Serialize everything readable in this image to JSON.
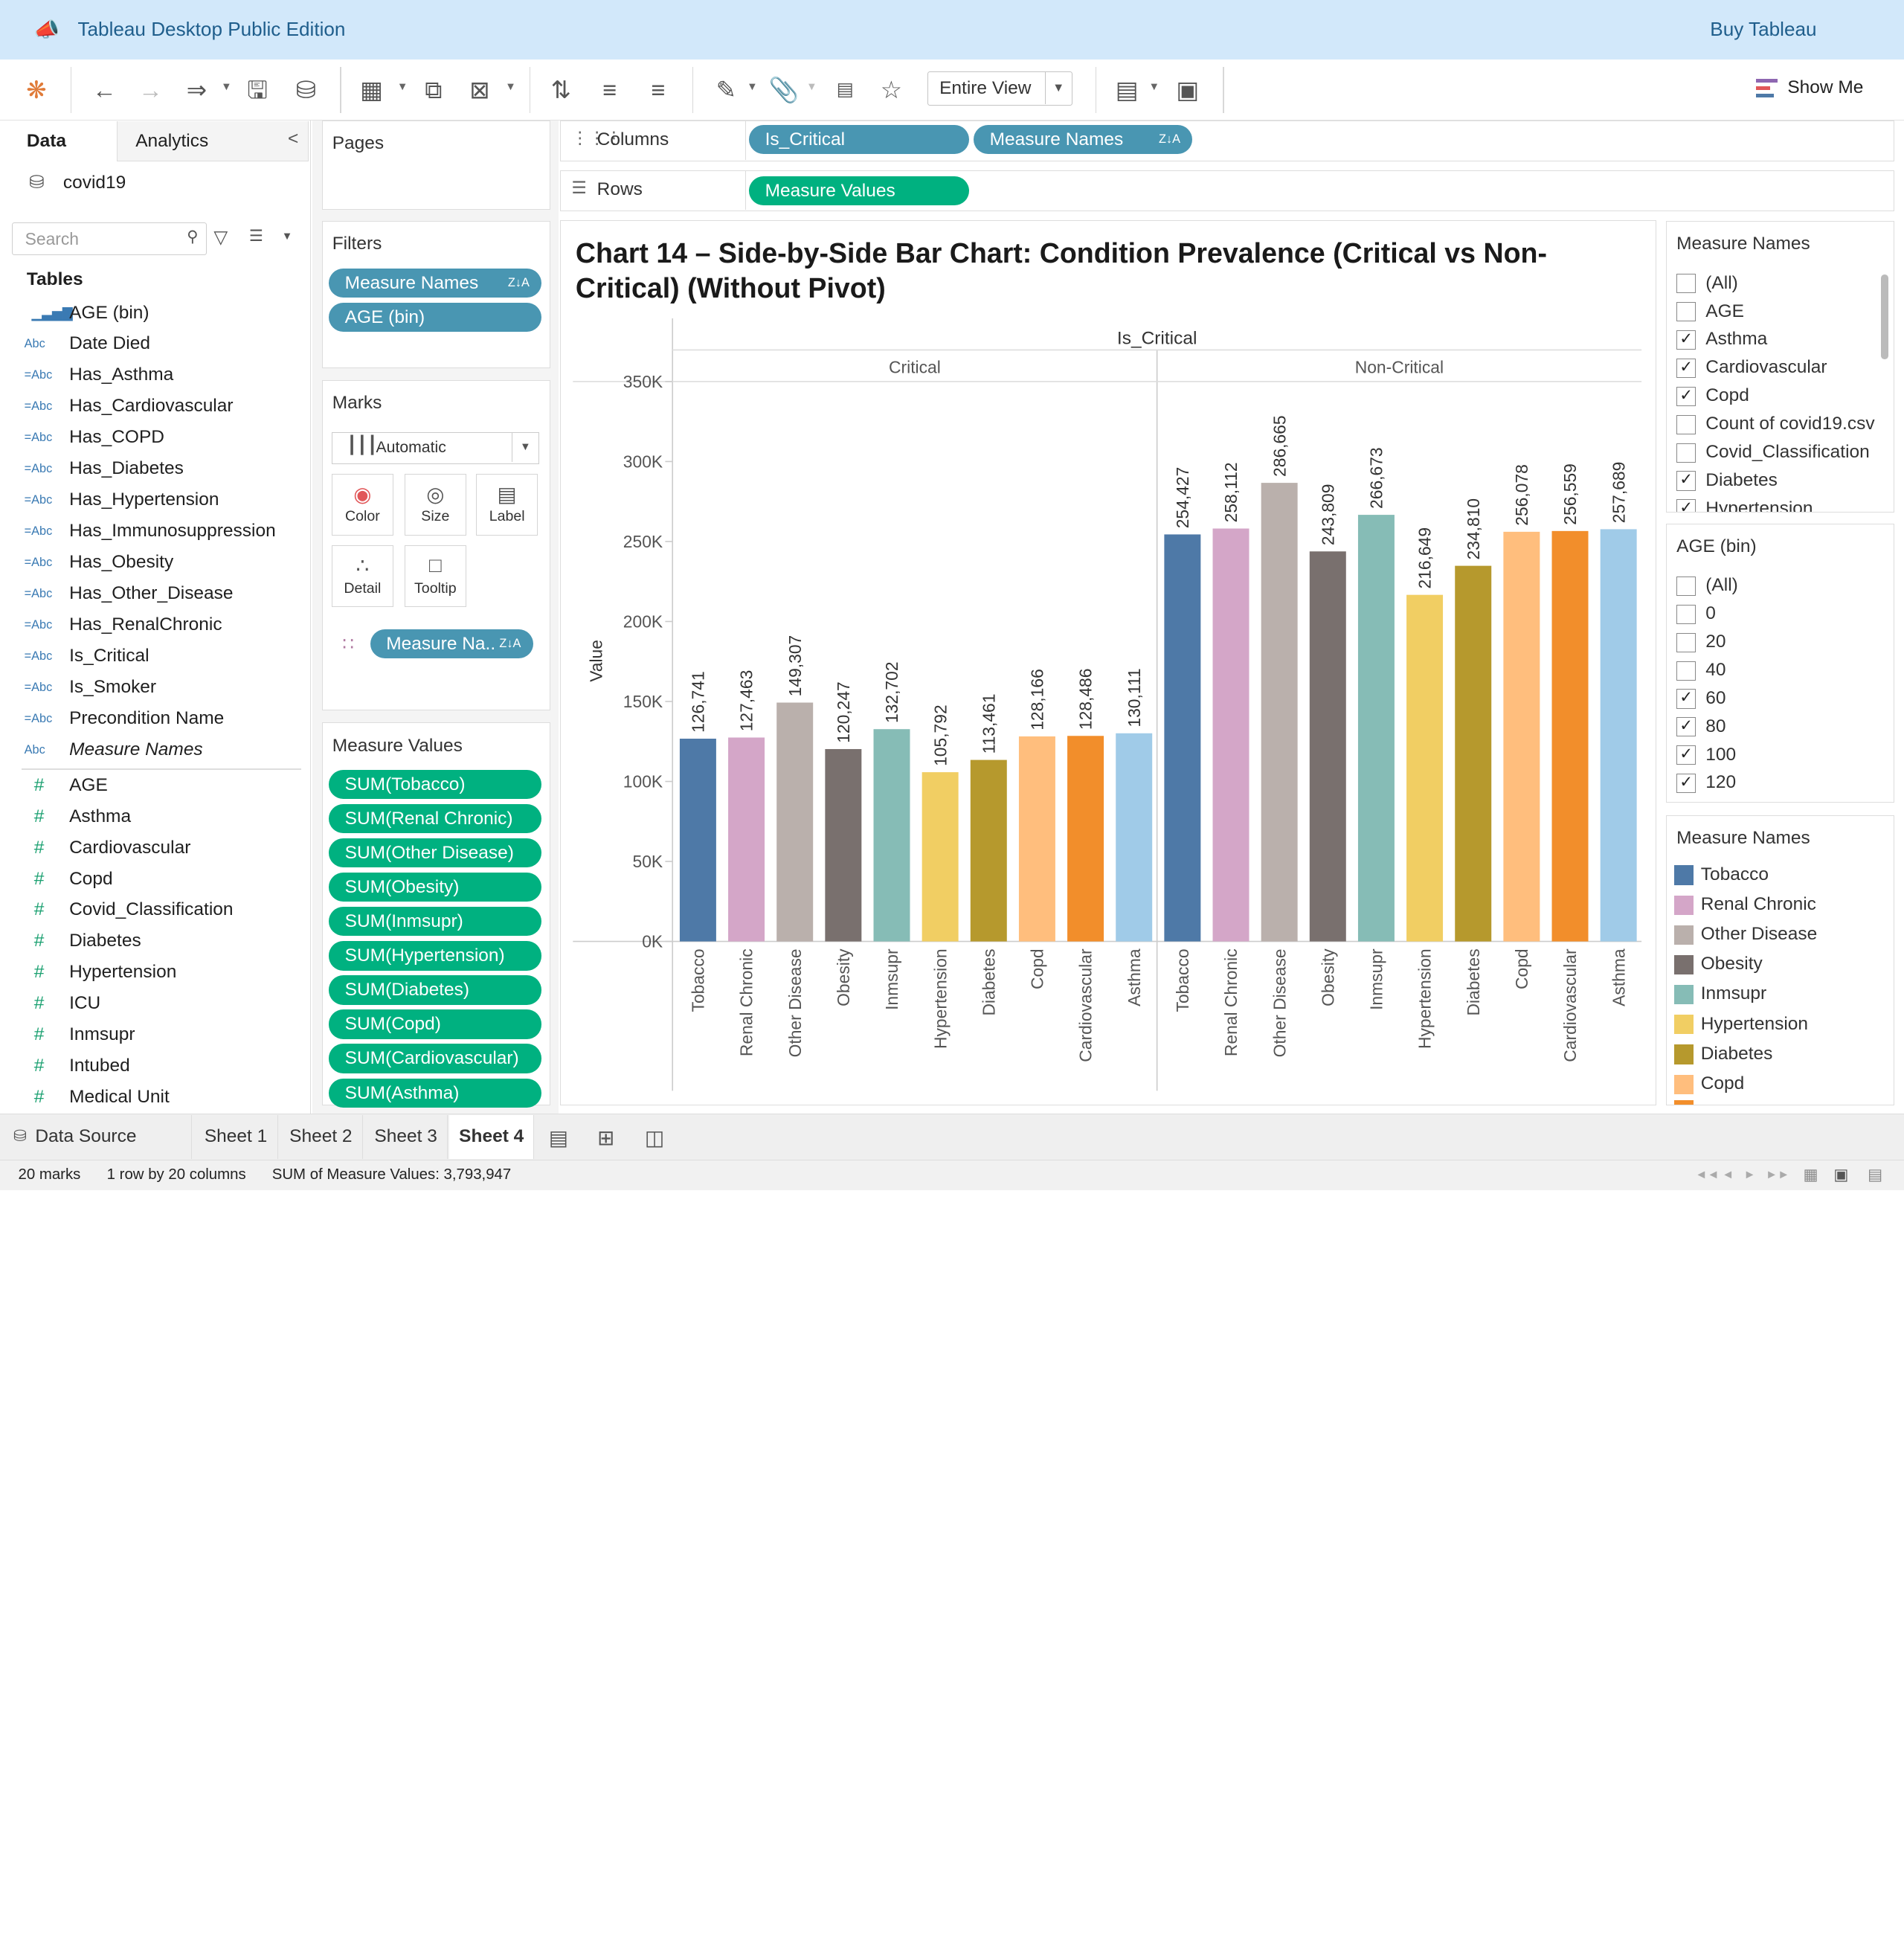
{
  "app": {
    "title": "Tableau Desktop Public Edition",
    "buy": "Buy Tableau",
    "fit": "Entire View",
    "show_me": "Show Me"
  },
  "sidebar": {
    "tab_data": "Data",
    "tab_analytics": "Analytics",
    "datasource": "covid19",
    "search_placeholder": "Search",
    "tables_heading": "Tables",
    "dims": [
      {
        "icon": "bin",
        "label": "AGE (bin)"
      },
      {
        "icon": "Abc",
        "label": "Date Died"
      },
      {
        "icon": "=Abc",
        "label": "Has_Asthma"
      },
      {
        "icon": "=Abc",
        "label": "Has_Cardiovascular"
      },
      {
        "icon": "=Abc",
        "label": "Has_COPD"
      },
      {
        "icon": "=Abc",
        "label": "Has_Diabetes"
      },
      {
        "icon": "=Abc",
        "label": "Has_Hypertension"
      },
      {
        "icon": "=Abc",
        "label": "Has_Immunosuppression"
      },
      {
        "icon": "=Abc",
        "label": "Has_Obesity"
      },
      {
        "icon": "=Abc",
        "label": "Has_Other_Disease"
      },
      {
        "icon": "=Abc",
        "label": "Has_RenalChronic"
      },
      {
        "icon": "=Abc",
        "label": "Is_Critical"
      },
      {
        "icon": "=Abc",
        "label": "Is_Smoker"
      },
      {
        "icon": "=Abc",
        "label": "Precondition Name"
      },
      {
        "icon": "Abc",
        "label": "Measure Names"
      }
    ],
    "measures": [
      "AGE",
      "Asthma",
      "Cardiovascular",
      "Copd",
      "Covid_Classification",
      "Diabetes",
      "Hypertension",
      "ICU",
      "Inmsupr",
      "Intubed",
      "Medical Unit"
    ]
  },
  "pages": {
    "title": "Pages"
  },
  "filters": {
    "title": "Filters",
    "pills": [
      "Measure Names",
      "AGE (bin)"
    ]
  },
  "marks": {
    "title": "Marks",
    "type": "Automatic",
    "buttons": [
      "Color",
      "Size",
      "Label",
      "Detail",
      "Tooltip"
    ],
    "color_pill": "Measure Na.."
  },
  "measure_values": {
    "title": "Measure Values",
    "pills": [
      "SUM(Tobacco)",
      "SUM(Renal Chronic)",
      "SUM(Other Disease)",
      "SUM(Obesity)",
      "SUM(Inmsupr)",
      "SUM(Hypertension)",
      "SUM(Diabetes)",
      "SUM(Copd)",
      "SUM(Cardiovascular)",
      "SUM(Asthma)"
    ]
  },
  "shelves": {
    "columns_label": "Columns",
    "rows_label": "Rows",
    "columns": [
      "Is_Critical",
      "Measure Names"
    ],
    "rows": [
      "Measure Values"
    ]
  },
  "chart_data": {
    "type": "bar",
    "title": "Chart 14 – Side-by-Side Bar Chart: Condition Prevalence (Critical vs Non-Critical) (Without Pivot)",
    "column_header": "Is_Critical",
    "ylabel": "Value",
    "ylim": [
      0,
      350000
    ],
    "yticks": [
      "0K",
      "50K",
      "100K",
      "150K",
      "200K",
      "250K",
      "300K",
      "350K"
    ],
    "categories": [
      "Tobacco",
      "Renal Chronic",
      "Other Disease",
      "Obesity",
      "Inmsupr",
      "Hypertension",
      "Diabetes",
      "Copd",
      "Cardiovascular",
      "Asthma"
    ],
    "colors": [
      "#4e79a7",
      "#d4a6c8",
      "#bab0ac",
      "#79706e",
      "#86bcb6",
      "#f1ce63",
      "#b6992d",
      "#ffbe7d",
      "#f28e2b",
      "#a0cbe8"
    ],
    "series": [
      {
        "name": "Critical",
        "values": [
          126741,
          127463,
          149307,
          120247,
          132702,
          105792,
          113461,
          128166,
          128486,
          130111
        ]
      },
      {
        "name": "Non-Critical",
        "values": [
          254427,
          258112,
          286665,
          243809,
          266673,
          216649,
          234810,
          256078,
          256559,
          257689
        ]
      }
    ],
    "value_labels": [
      [
        "126,741",
        "127,463",
        "149,307",
        "120,247",
        "132,702",
        "105,792",
        "113,461",
        "128,166",
        "128,486",
        "130,111"
      ],
      [
        "254,427",
        "258,112",
        "286,665",
        "243,809",
        "266,673",
        "216,649",
        "234,810",
        "256,078",
        "256,559",
        "257,689"
      ]
    ]
  },
  "filter_measure_names": {
    "title": "Measure Names",
    "items": [
      {
        "label": "(All)",
        "checked": false
      },
      {
        "label": "AGE",
        "checked": false
      },
      {
        "label": "Asthma",
        "checked": true
      },
      {
        "label": "Cardiovascular",
        "checked": true
      },
      {
        "label": "Copd",
        "checked": true
      },
      {
        "label": "Count of covid19.csv",
        "checked": false
      },
      {
        "label": "Covid_Classification",
        "checked": false
      },
      {
        "label": "Diabetes",
        "checked": true
      },
      {
        "label": "Hypertension",
        "checked": true
      }
    ]
  },
  "filter_age": {
    "title": "AGE (bin)",
    "items": [
      {
        "label": "(All)",
        "checked": false
      },
      {
        "label": "0",
        "checked": false
      },
      {
        "label": "20",
        "checked": false
      },
      {
        "label": "40",
        "checked": false
      },
      {
        "label": "60",
        "checked": true
      },
      {
        "label": "80",
        "checked": true
      },
      {
        "label": "100",
        "checked": true
      },
      {
        "label": "120",
        "checked": true
      }
    ]
  },
  "legend": {
    "title": "Measure Names",
    "items": [
      "Tobacco",
      "Renal Chronic",
      "Other Disease",
      "Obesity",
      "Inmsupr",
      "Hypertension",
      "Diabetes",
      "Copd"
    ]
  },
  "sheet_tabs": [
    "Data Source",
    "Sheet 1",
    "Sheet 2",
    "Sheet 3",
    "Sheet 4"
  ],
  "status": {
    "marks": "20 marks",
    "dims": "1 row by 20 columns",
    "sum": "SUM of Measure Values: 3,793,947"
  }
}
